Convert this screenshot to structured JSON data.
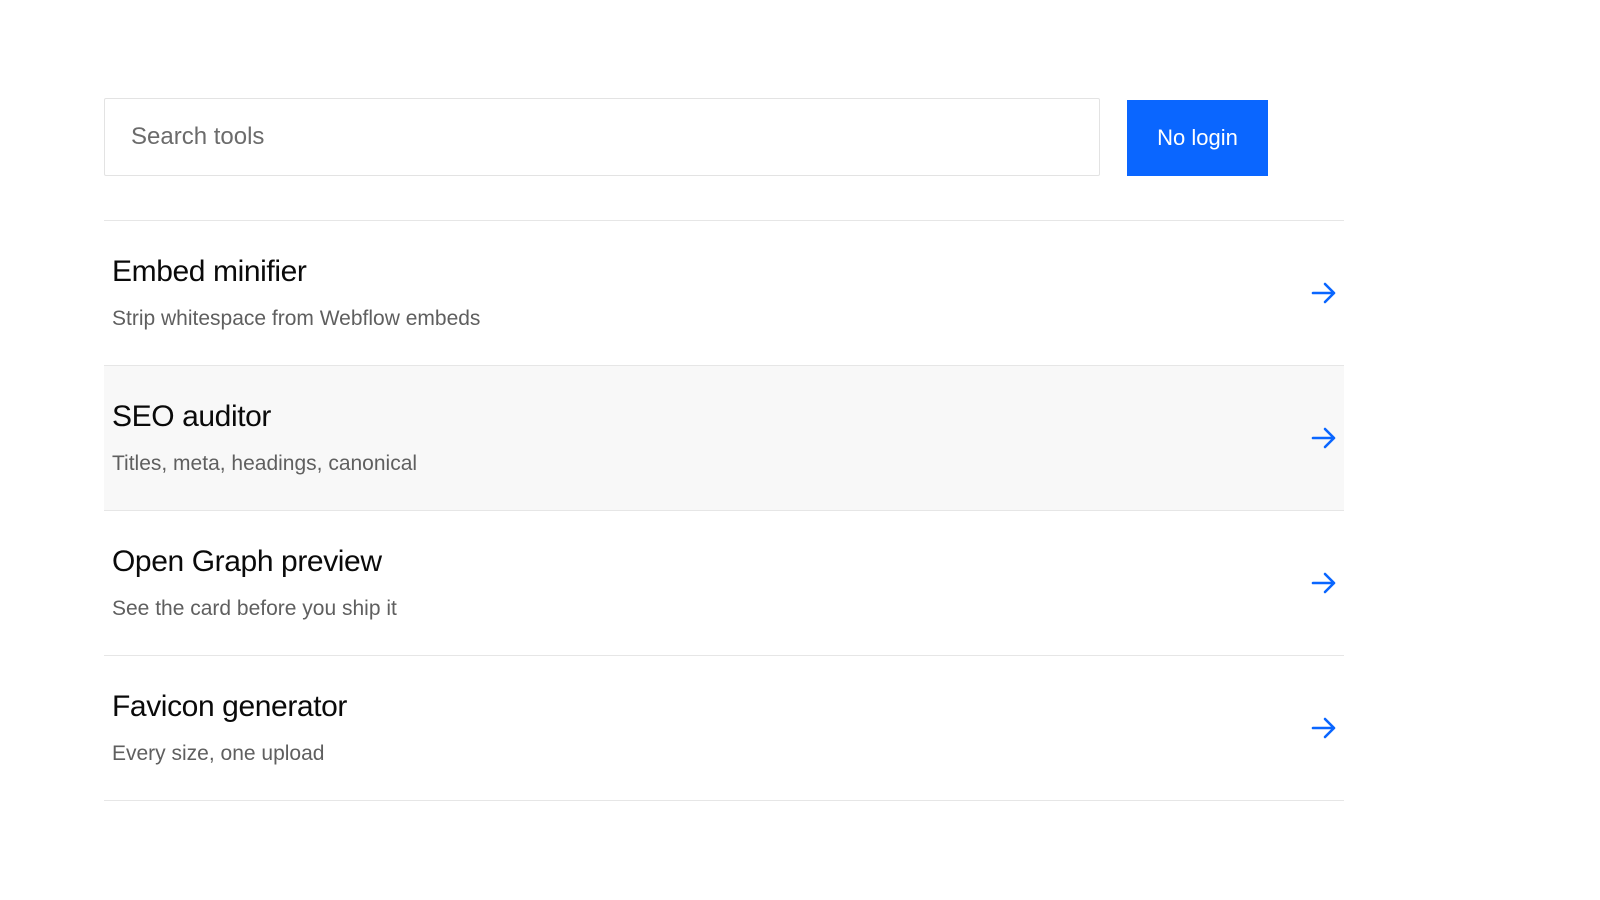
{
  "search": {
    "placeholder": "Search tools",
    "value": ""
  },
  "cta": {
    "label": "No login",
    "color": "#0a66ff"
  },
  "tools": [
    {
      "title": "Embed minifier",
      "description": "Strip whitespace from Webflow embeds",
      "icon": "arrow-right-icon"
    },
    {
      "title": "SEO auditor",
      "description": "Titles, meta, headings, canonical",
      "icon": "arrow-right-icon"
    },
    {
      "title": "Open Graph preview",
      "description": "See the card before you ship it",
      "icon": "arrow-right-icon"
    },
    {
      "title": "Favicon generator",
      "description": "Every size, one upload",
      "icon": "arrow-right-icon"
    }
  ],
  "colors": {
    "accent": "#0a66ff",
    "row_hover": "#f8f8f8",
    "divider": "#e6e6e6",
    "muted_text": "#5f5f5f"
  }
}
